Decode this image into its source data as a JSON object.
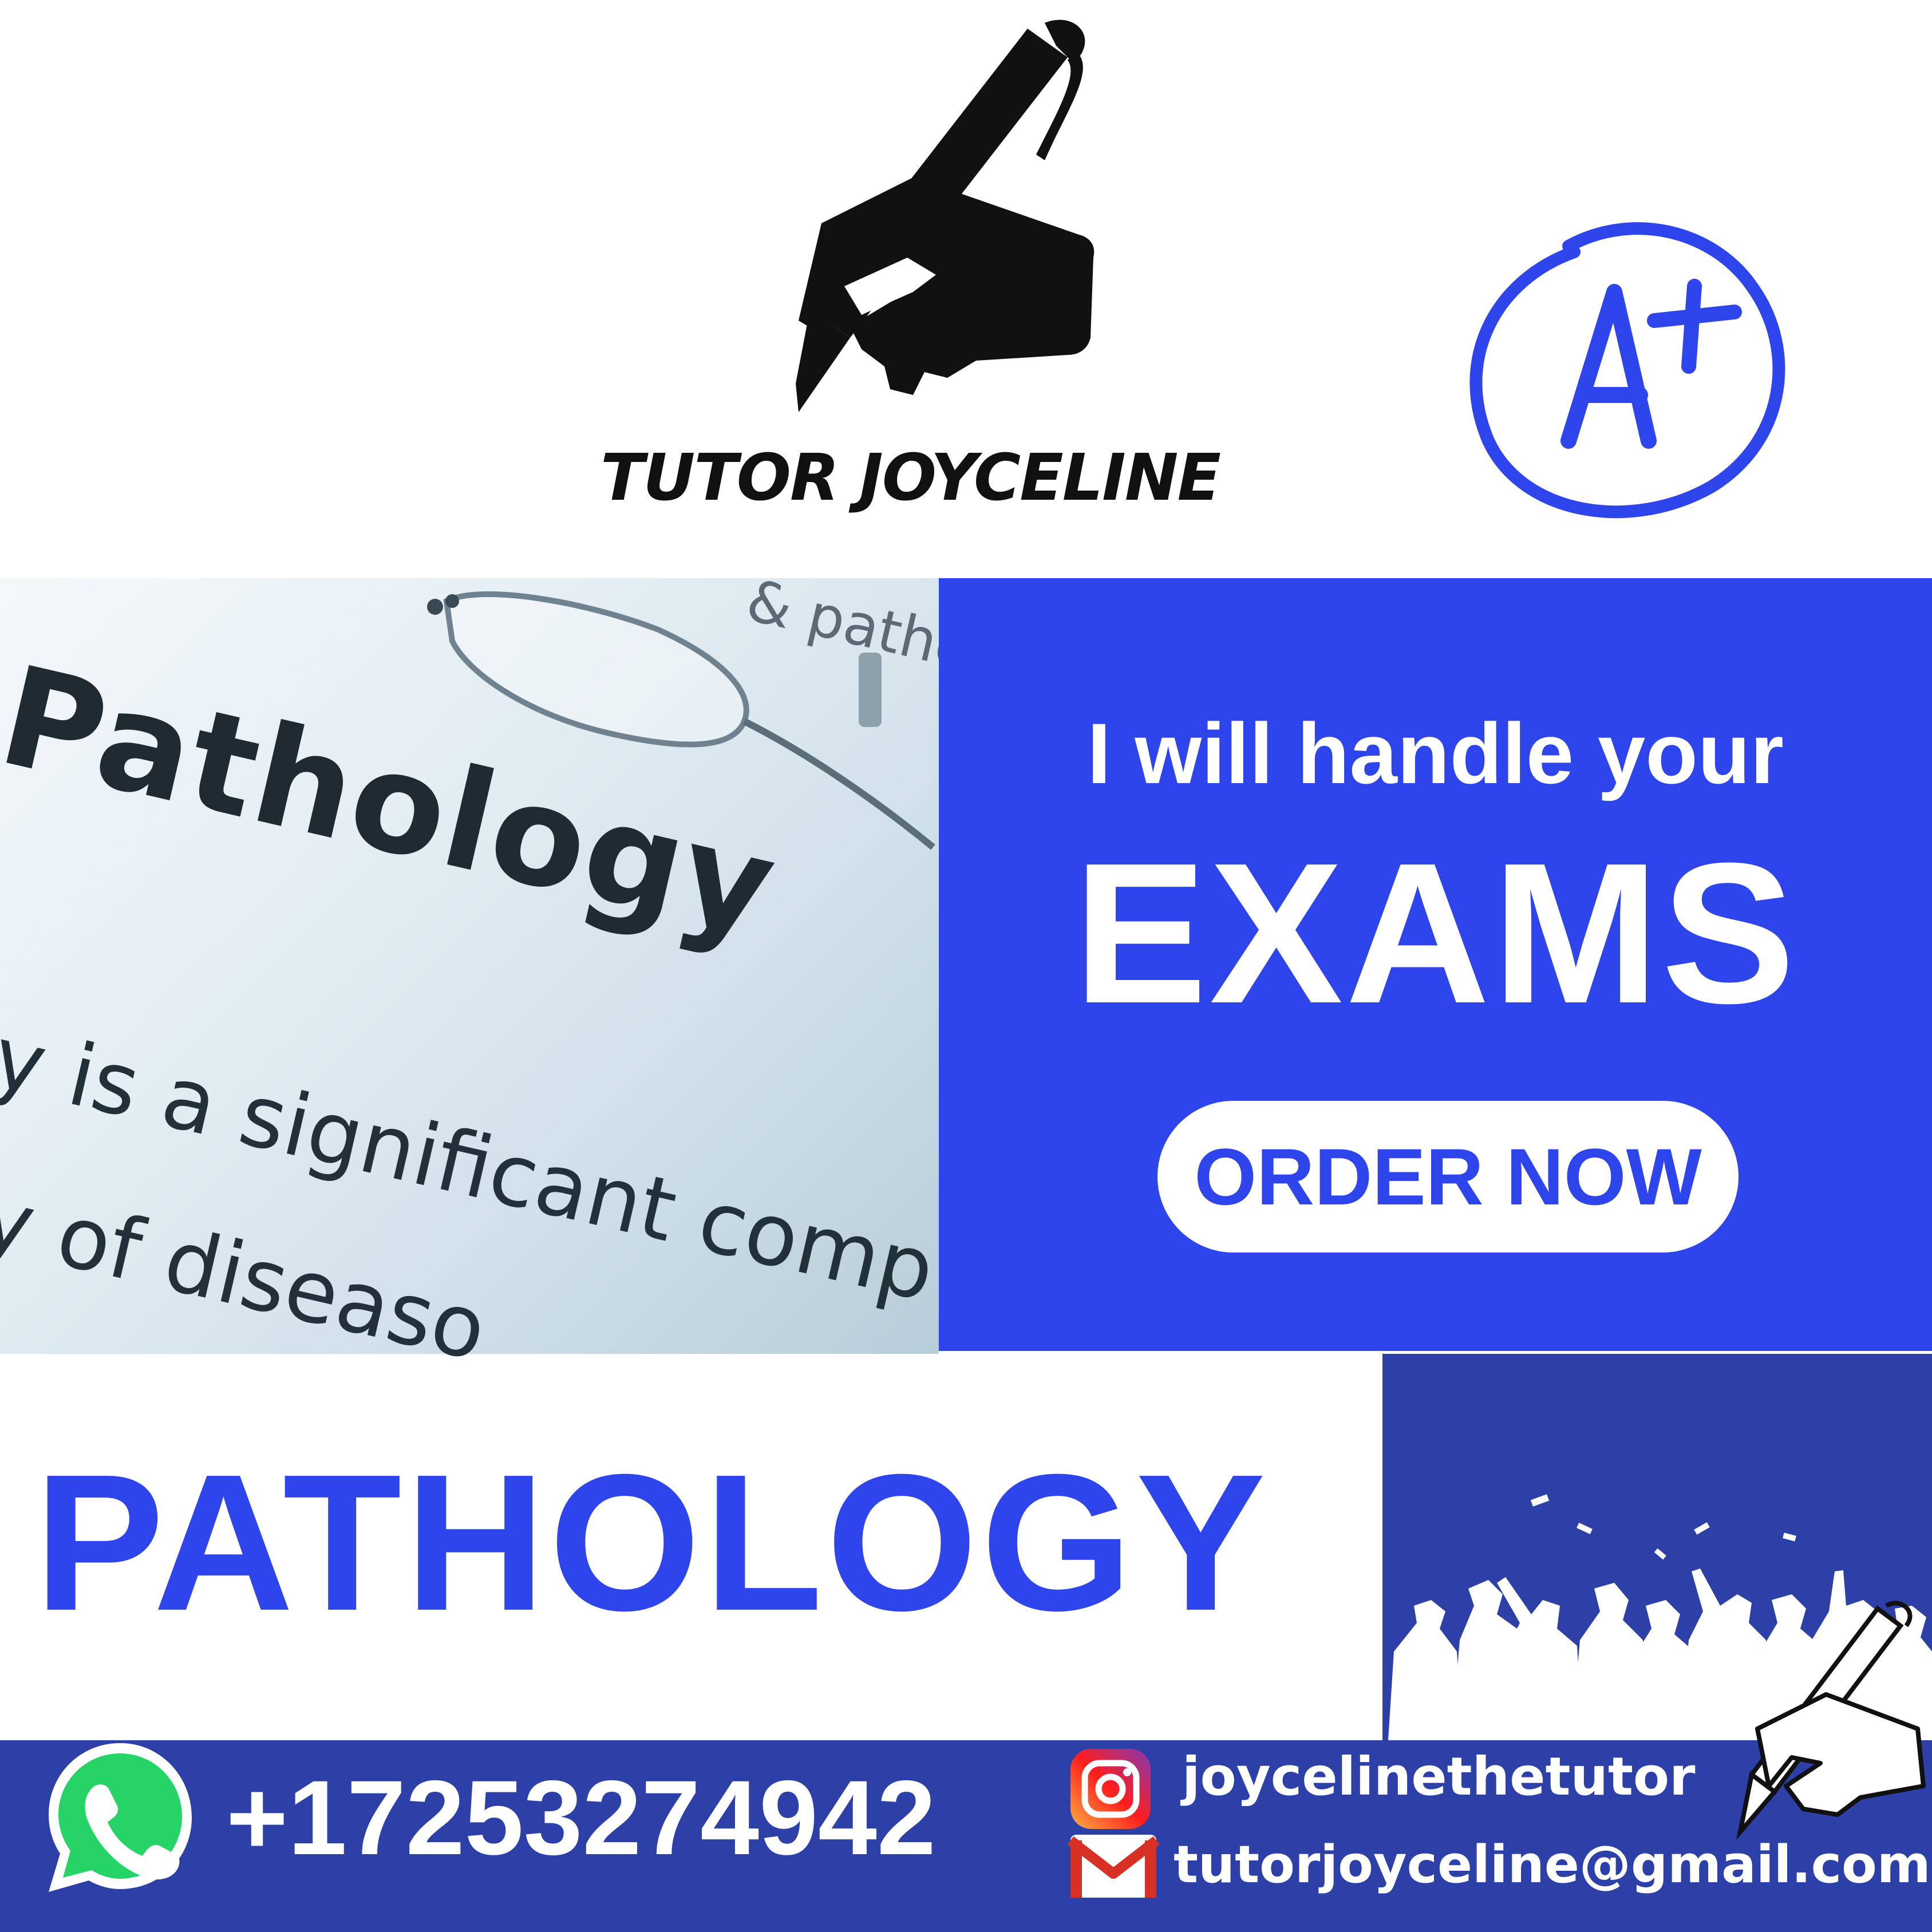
{
  "brand": {
    "name": "TUTOR JOYCELINE"
  },
  "grade": {
    "label": "A+"
  },
  "photo": {
    "word": "Pathology",
    "text_top": "& patho",
    "line1": "y is a significant comp",
    "line2": "y of diseaso"
  },
  "promo": {
    "line1": "I will handle your",
    "line2": "EXAMS",
    "cta": "ORDER NOW",
    "color": "#2f45ec"
  },
  "subject": {
    "title": "PATHOLOGY"
  },
  "contact": {
    "phone": "+17253274942",
    "instagram": "joycelinethetutor",
    "email": "tutorjoyceline@gmail.com"
  },
  "icons": [
    "pen-hand-icon",
    "a-plus-grade-icon",
    "whatsapp-icon",
    "instagram-icon",
    "gmail-icon",
    "graduates-silhouette-icon"
  ],
  "colors": {
    "accent": "#2f45ec",
    "footer": "#2c40a8",
    "whatsapp": "#25d366"
  }
}
